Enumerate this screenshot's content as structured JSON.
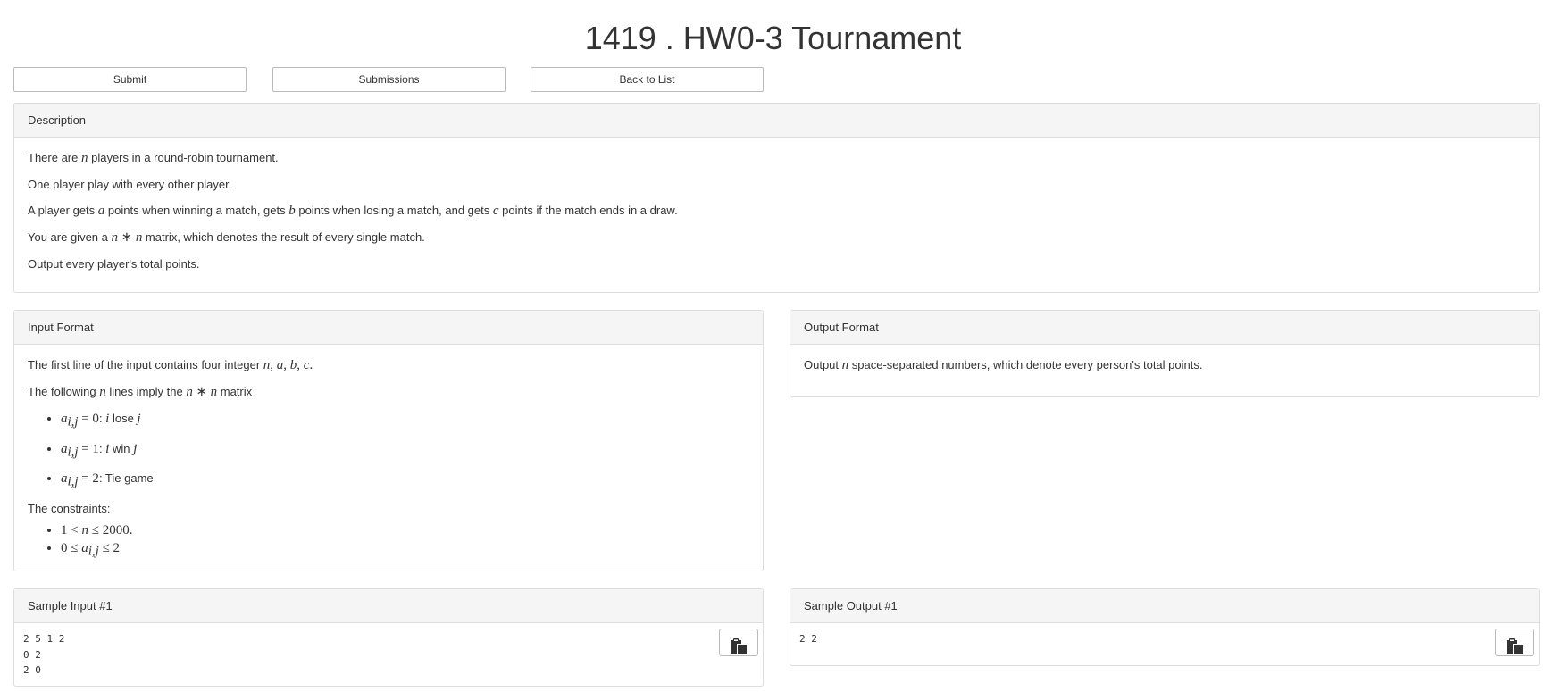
{
  "page": {
    "title": "1419 . HW0-3 Tournament"
  },
  "toolbar": {
    "submit_label": "Submit",
    "submissions_label": "Submissions",
    "back_label": "Back to List"
  },
  "description": {
    "heading": "Description",
    "line1_pre": "There are ",
    "line1_post": " players in a round-robin tournament.",
    "line2": "One player play with every other player.",
    "line3_a": "A player gets ",
    "line3_b": " points when winning a match, gets ",
    "line3_c": " points when losing a match, and gets ",
    "line3_d": " points if the match ends in a draw.",
    "line4_pre": "You are given a ",
    "line4_post": " matrix, which denotes the result of every single match.",
    "line5": "Output every player's total points."
  },
  "input_format": {
    "heading": "Input Format",
    "line1_pre": "The first line of the input contains four integer ",
    "line2_pre": "The following ",
    "line2_mid": " lines imply the ",
    "line2_post": " matrix",
    "items": [
      ": ",
      ": ",
      ": Tie game"
    ],
    "item_words": [
      " lose ",
      " win "
    ],
    "constraints_label": "The constraints:"
  },
  "output_format": {
    "heading": "Output Format",
    "line_pre": "Output ",
    "line_post": " space-separated numbers, which denote every person's total points."
  },
  "sample_input": {
    "heading": "Sample Input #1",
    "content": "2 5 1 2\n0 2\n2 0"
  },
  "sample_output": {
    "heading": "Sample Output #1",
    "content": "2 2"
  },
  "icons": {
    "copy": "clipboard-icon"
  }
}
